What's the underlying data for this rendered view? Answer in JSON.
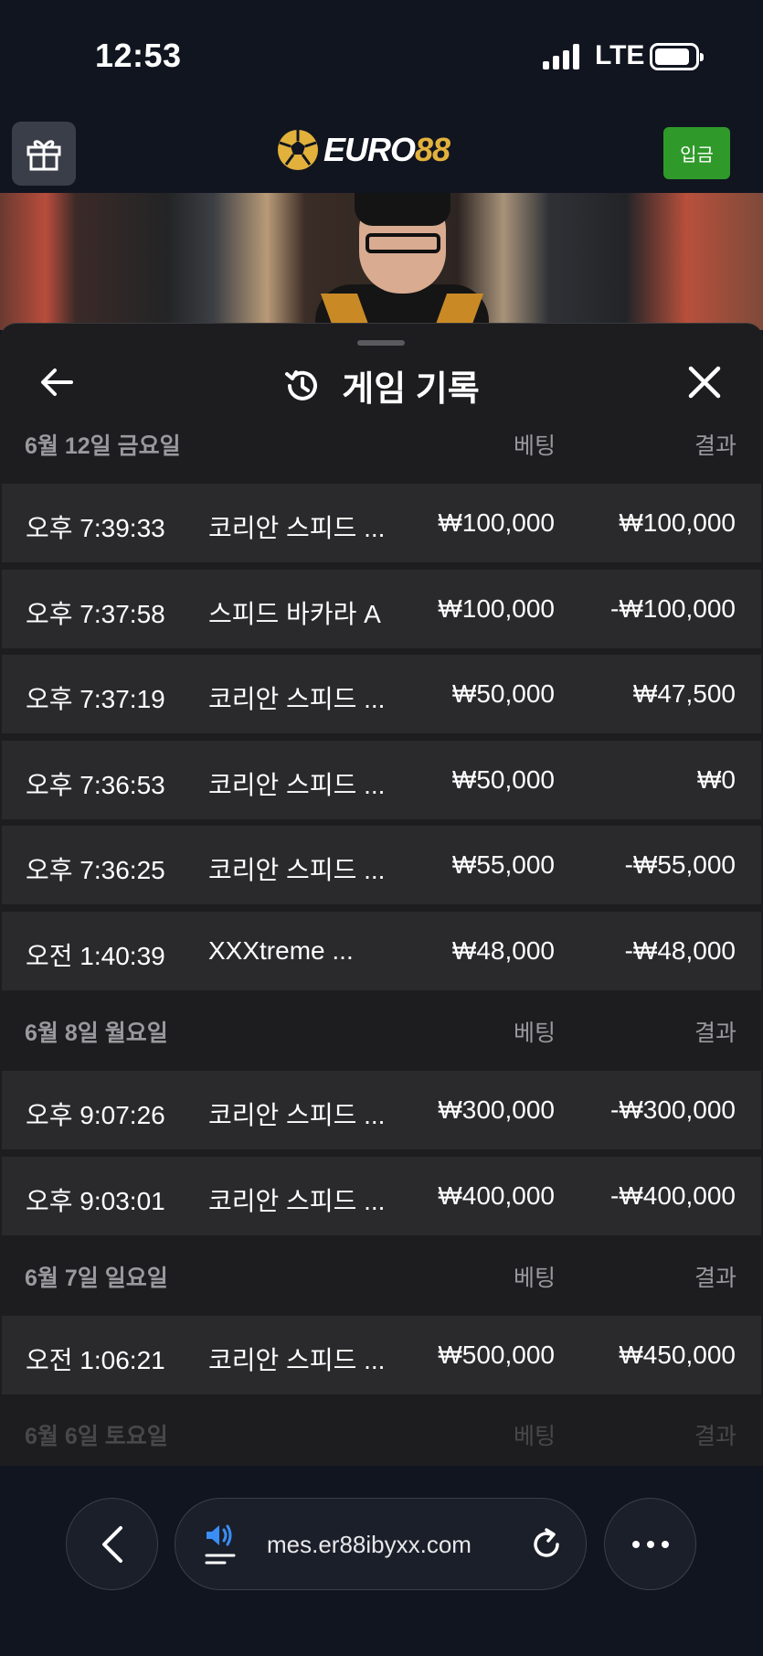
{
  "status_bar": {
    "time": "12:53",
    "network": "LTE"
  },
  "header": {
    "logo_text_white": "EURO",
    "logo_text_gold": "88",
    "deposit_label": "입금"
  },
  "sheet": {
    "title": "게임 기록",
    "groups": [
      {
        "date": "6월 12일 금요일",
        "bet_header": "베팅",
        "result_header": "결과",
        "rows": [
          {
            "time": "오후 7:39:33",
            "game": "코리안 스피드 ...",
            "bet": "₩100,000",
            "result": "₩100,000"
          },
          {
            "time": "오후 7:37:58",
            "game": "스피드 바카라 A",
            "bet": "₩100,000",
            "result": "-₩100,000"
          },
          {
            "time": "오후 7:37:19",
            "game": "코리안 스피드 ...",
            "bet": "₩50,000",
            "result": "₩47,500"
          },
          {
            "time": "오후 7:36:53",
            "game": "코리안 스피드 ...",
            "bet": "₩50,000",
            "result": "₩0"
          },
          {
            "time": "오후 7:36:25",
            "game": "코리안 스피드 ...",
            "bet": "₩55,000",
            "result": "-₩55,000"
          },
          {
            "time": "오전 1:40:39",
            "game": "XXXtreme ...",
            "bet": "₩48,000",
            "result": "-₩48,000"
          }
        ]
      },
      {
        "date": "6월 8일 월요일",
        "bet_header": "베팅",
        "result_header": "결과",
        "rows": [
          {
            "time": "오후 9:07:26",
            "game": "코리안 스피드 ...",
            "bet": "₩300,000",
            "result": "-₩300,000"
          },
          {
            "time": "오후 9:03:01",
            "game": "코리안 스피드 ...",
            "bet": "₩400,000",
            "result": "-₩400,000"
          }
        ]
      },
      {
        "date": "6월 7일 일요일",
        "bet_header": "베팅",
        "result_header": "결과",
        "rows": [
          {
            "time": "오전 1:06:21",
            "game": "코리안 스피드 ...",
            "bet": "₩500,000",
            "result": "₩450,000"
          }
        ]
      },
      {
        "date": "6월 6일 토요일",
        "bet_header": "베팅",
        "result_header": "결과",
        "rows": []
      }
    ]
  },
  "browser": {
    "url": "mes.er88ibyxx.com"
  },
  "colors": {
    "deposit_green": "#2f9a2a",
    "logo_gold": "#e2b13c",
    "sheet_bg": "#1d1d1f",
    "row_bg": "#2a2a2c"
  }
}
